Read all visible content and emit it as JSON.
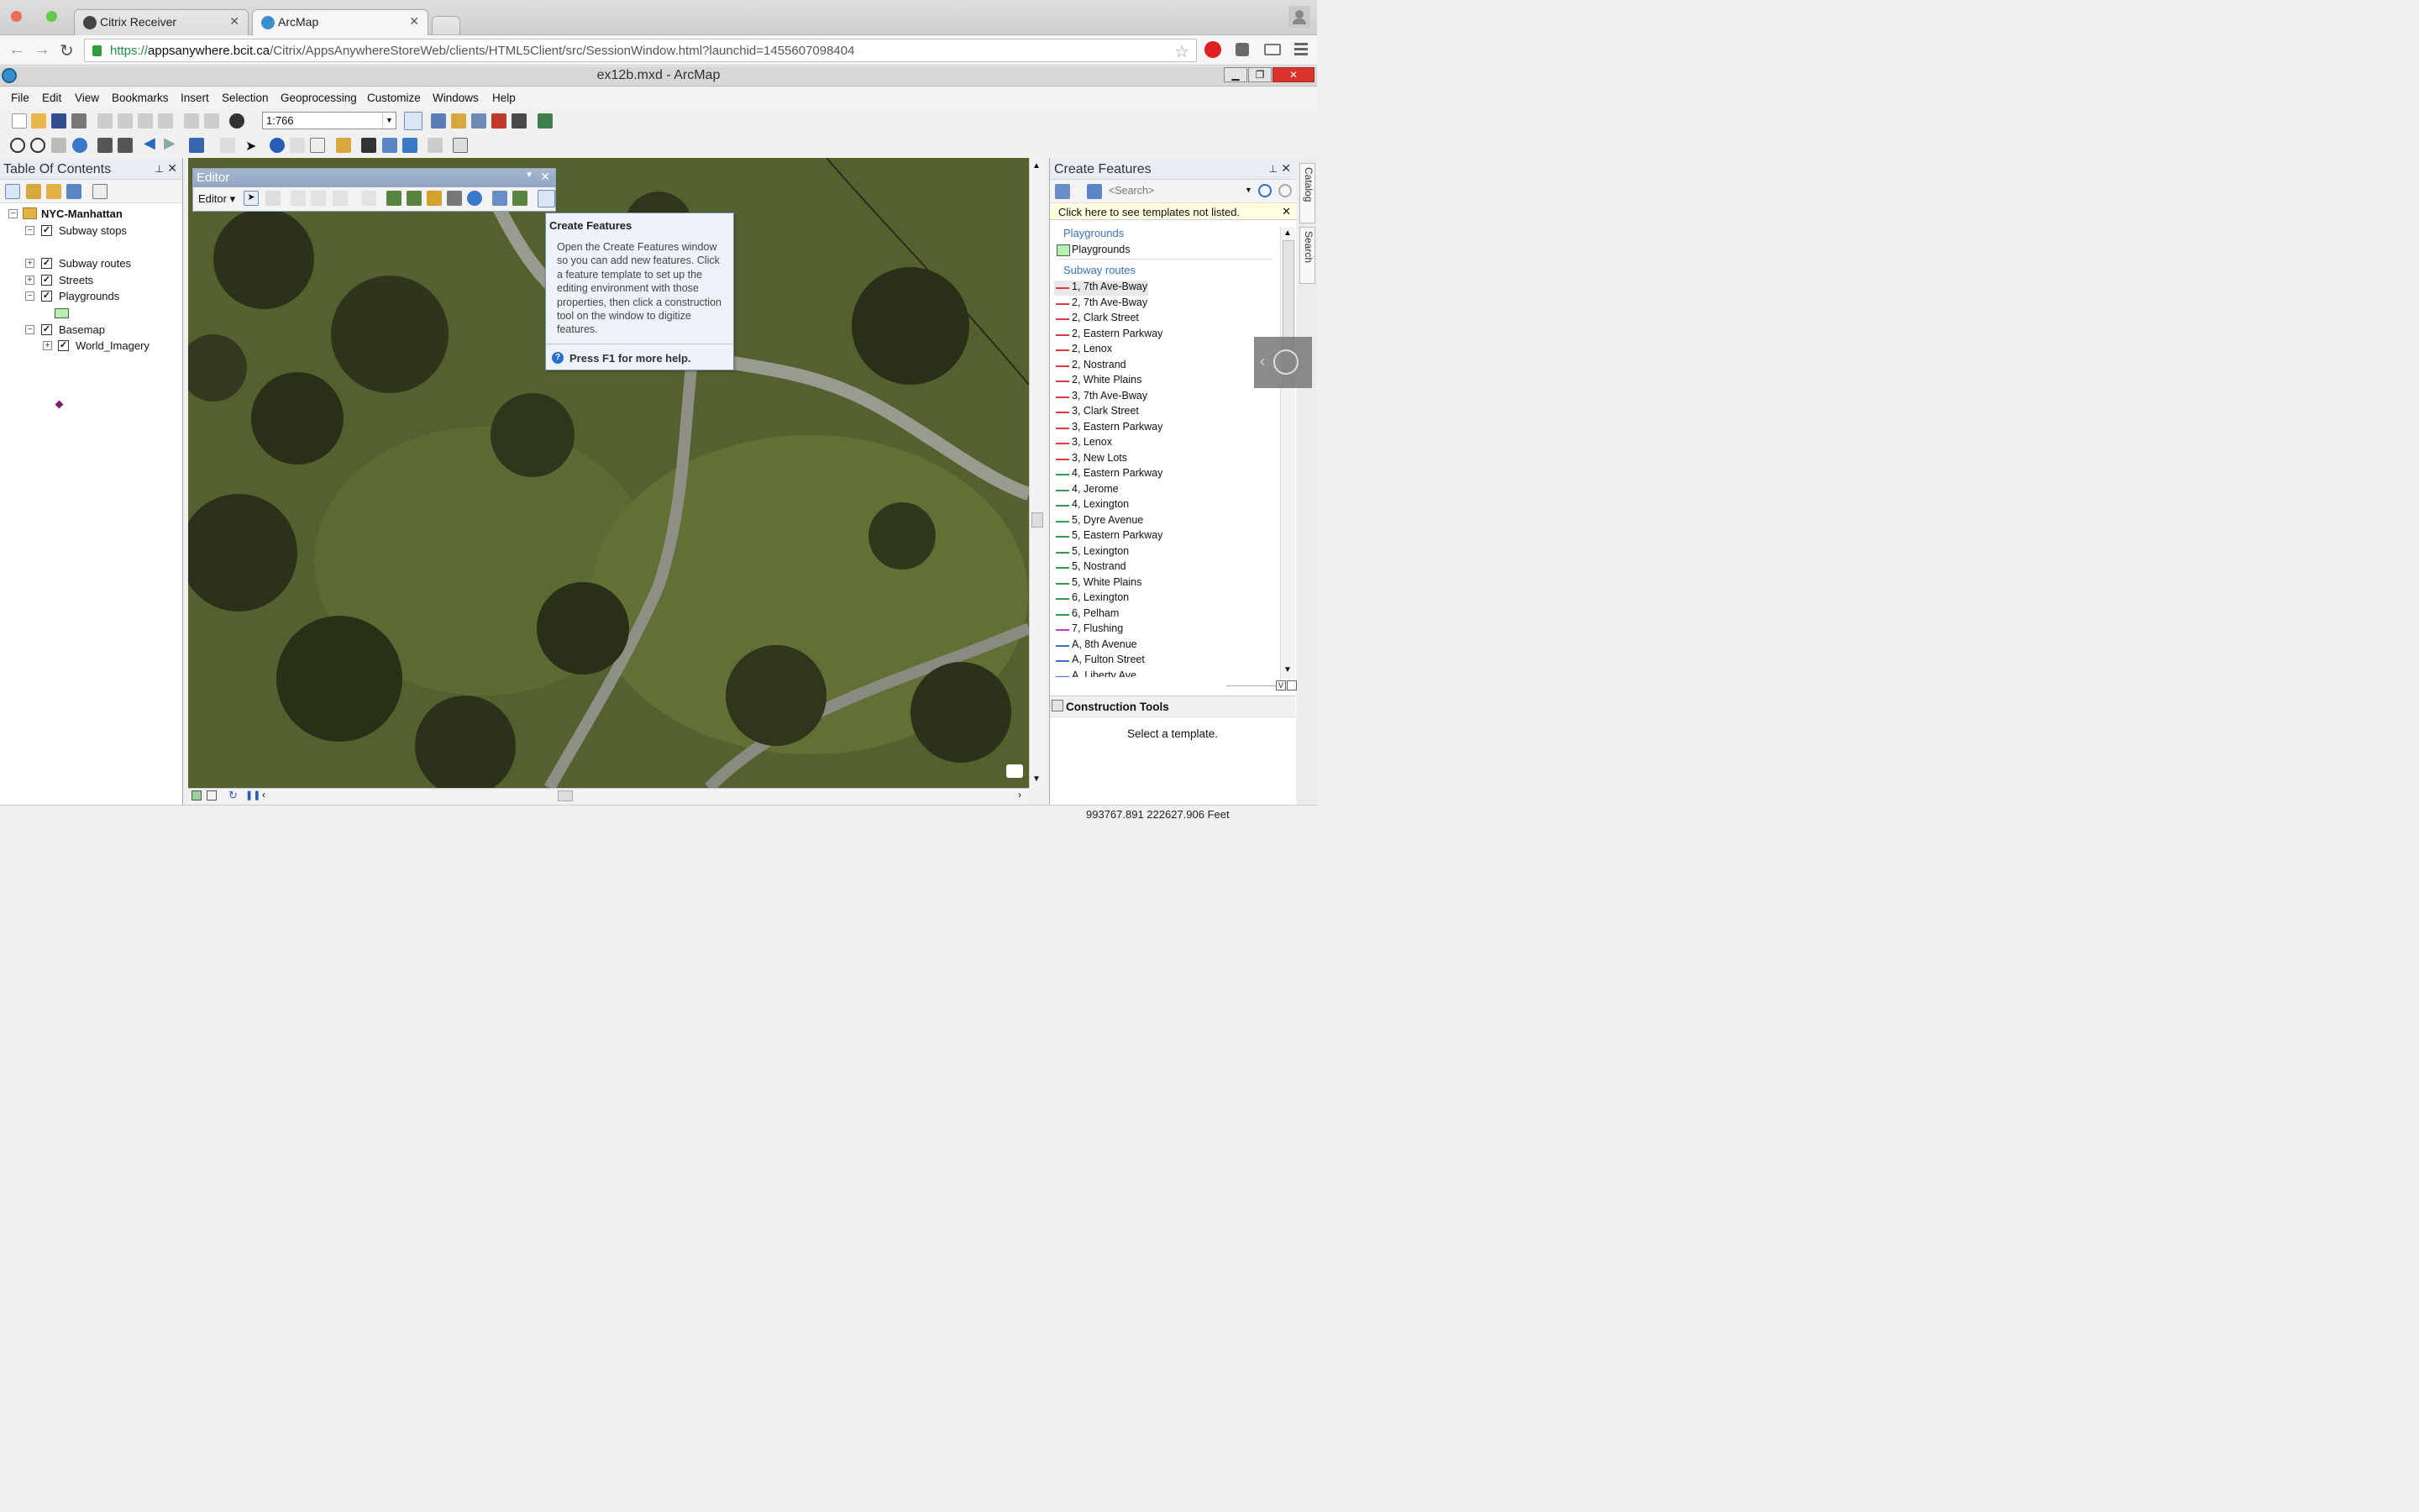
{
  "browser": {
    "tabs": [
      {
        "label": "Citrix Receiver",
        "active": false
      },
      {
        "label": "ArcMap",
        "active": true
      }
    ],
    "url": {
      "scheme": "https://",
      "host": "appsanywhere.bcit.ca",
      "path": "/Citrix/AppsAnywhereStoreWeb/clients/HTML5Client/src/SessionWindow.html?launchid=1455607098404"
    }
  },
  "window": {
    "title": "ex12b.mxd - ArcMap",
    "close_glyph": "✕"
  },
  "menu": [
    "File",
    "Edit",
    "View",
    "Bookmarks",
    "Insert",
    "Selection",
    "Geoprocessing",
    "Customize",
    "Windows",
    "Help"
  ],
  "toolbar": {
    "scale": "1:766"
  },
  "toc": {
    "title": "Table Of Contents",
    "frame": "NYC-Manhattan",
    "layers": {
      "subway_stops": "Subway stops",
      "subway_routes": "Subway routes",
      "streets": "Streets",
      "playgrounds": "Playgrounds",
      "basemap": "Basemap",
      "world_imagery": "World_Imagery"
    }
  },
  "editor": {
    "title": "Editor",
    "menu_label": "Editor"
  },
  "tooltip": {
    "title": "Create Features",
    "body": "Open the Create Features window so you can add new features. Click a feature template to set up the editing environment with those properties, then click a construction tool on the window to digitize features.",
    "help": "Press F1 for more help."
  },
  "create_features": {
    "title": "Create Features",
    "search_placeholder": "<Search>",
    "not_listed": "Click here to see templates not listed.",
    "groups": {
      "playgrounds": {
        "title": "Playgrounds",
        "items": [
          "Playgrounds"
        ]
      },
      "subway_routes": {
        "title": "Subway routes",
        "items": [
          {
            "label": "1, 7th Ave-Bway",
            "color": "#e03b3b"
          },
          {
            "label": "2, 7th Ave-Bway",
            "color": "#e03b3b"
          },
          {
            "label": "2, Clark Street",
            "color": "#e03b3b"
          },
          {
            "label": "2, Eastern Parkway",
            "color": "#e03b3b"
          },
          {
            "label": "2, Lenox",
            "color": "#e03b3b"
          },
          {
            "label": "2, Nostrand",
            "color": "#e03b3b"
          },
          {
            "label": "2, White Plains",
            "color": "#e03b3b"
          },
          {
            "label": "3, 7th Ave-Bway",
            "color": "#e03b3b"
          },
          {
            "label": "3, Clark Street",
            "color": "#e03b3b"
          },
          {
            "label": "3, Eastern Parkway",
            "color": "#e03b3b"
          },
          {
            "label": "3, Lenox",
            "color": "#e03b3b"
          },
          {
            "label": "3, New Lots",
            "color": "#e03b3b"
          },
          {
            "label": "4, Eastern Parkway",
            "color": "#2e9e4a"
          },
          {
            "label": "4, Jerome",
            "color": "#2e9e4a"
          },
          {
            "label": "4, Lexington",
            "color": "#2e9e4a"
          },
          {
            "label": "5, Dyre Avenue",
            "color": "#2e9e4a"
          },
          {
            "label": "5, Eastern Parkway",
            "color": "#2e9e4a"
          },
          {
            "label": "5, Lexington",
            "color": "#2e9e4a"
          },
          {
            "label": "5, Nostrand",
            "color": "#2e9e4a"
          },
          {
            "label": "5, White Plains",
            "color": "#2e9e4a"
          },
          {
            "label": "6, Lexington",
            "color": "#2e9e4a"
          },
          {
            "label": "6, Pelham",
            "color": "#2e9e4a"
          },
          {
            "label": "7, Flushing",
            "color": "#c33bc3"
          },
          {
            "label": "A, 8th Avenue",
            "color": "#3b6fd0"
          },
          {
            "label": "A, Fulton Street",
            "color": "#3b6fd0"
          },
          {
            "label": "A, Liberty Ave",
            "color": "#3b6fd0"
          }
        ]
      }
    },
    "selected_item": "1, 7th Ave-Bway"
  },
  "construction_tools": {
    "title": "Construction Tools",
    "message": "Select a template."
  },
  "side_tabs": [
    "Catalog",
    "Search"
  ],
  "status": {
    "coords": "993767.891  222627.906 Feet"
  },
  "colors": {
    "playground_fill": "#b6f0b0",
    "stop_marker": "#7a1f6e",
    "group_header": "#3d6fb7"
  }
}
